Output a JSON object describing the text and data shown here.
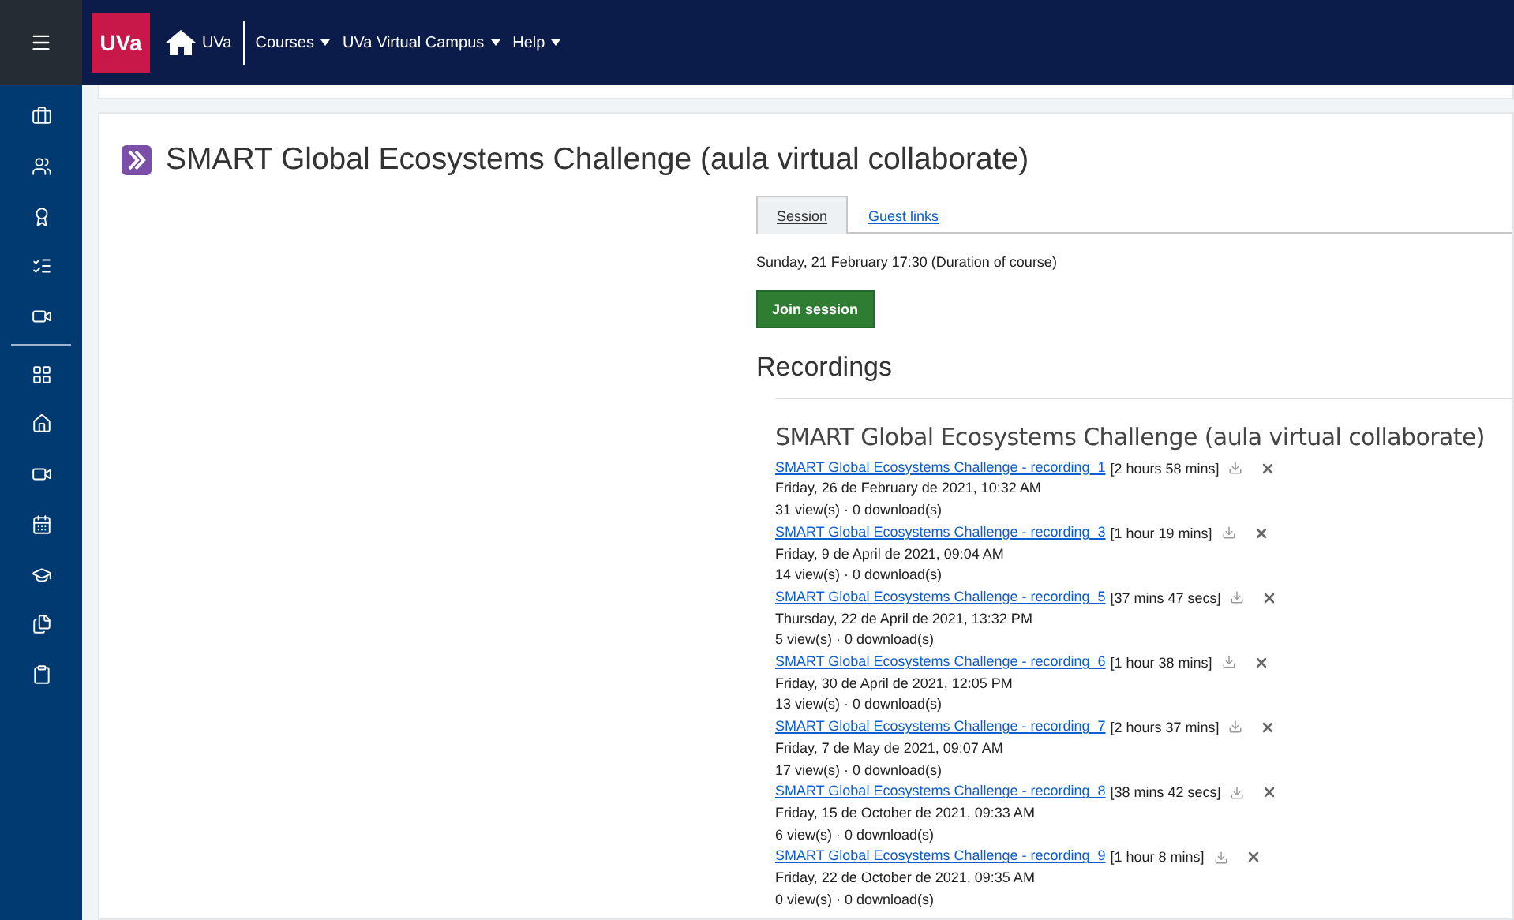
{
  "navbar": {
    "logo": "UVa",
    "home_label": "UVa",
    "menus": [
      {
        "label": "Courses"
      },
      {
        "label": "UVa Virtual Campus"
      },
      {
        "label": "Help"
      }
    ]
  },
  "page": {
    "title": "SMART Global Ecosystems Challenge (aula virtual collaborate)",
    "tabs": [
      {
        "label": "Session",
        "selected": true
      },
      {
        "label": "Guest links",
        "selected": false
      }
    ],
    "session_time": "Sunday, 21 February 17:30 (Duration of course)",
    "join_button": "Join session",
    "recordings_heading": "Recordings",
    "recordings_title": "SMART Global Ecosystems Challenge (aula virtual collaborate)",
    "recordings": [
      {
        "link": "SMART Global Ecosystems Challenge - recording_1",
        "duration": "[2 hours 58 mins]",
        "date": "Friday, 26 de February de 2021, 10:32 AM",
        "stats": "31 view(s) · 0 download(s)"
      },
      {
        "link": "SMART Global Ecosystems Challenge - recording_3",
        "duration": "[1 hour 19 mins]",
        "date": "Friday, 9 de April de 2021, 09:04 AM",
        "stats": "14 view(s) · 0 download(s)"
      },
      {
        "link": "SMART Global Ecosystems Challenge - recording_5",
        "duration": "[37 mins 47 secs]",
        "date": "Thursday, 22 de April de 2021, 13:32 PM",
        "stats": "5 view(s) · 0 download(s)"
      },
      {
        "link": "SMART Global Ecosystems Challenge - recording_6",
        "duration": "[1 hour 38 mins]",
        "date": "Friday, 30 de April de 2021, 12:05 PM",
        "stats": "13 view(s) · 0 download(s)"
      },
      {
        "link": "SMART Global Ecosystems Challenge - recording_7",
        "duration": "[2 hours 37 mins]",
        "date": "Friday, 7 de May de 2021, 09:07 AM",
        "stats": "17 view(s) · 0 download(s)"
      },
      {
        "link": "SMART Global Ecosystems Challenge - recording_8",
        "duration": "[38 mins 42 secs]",
        "date": "Friday, 15 de October de 2021, 09:33 AM",
        "stats": "6 view(s) · 0 download(s)"
      },
      {
        "link": "SMART Global Ecosystems Challenge - recording_9",
        "duration": "[1 hour 8 mins]",
        "date": "Friday, 22 de October de 2021, 09:35 AM",
        "stats": "0 view(s) · 0 download(s)"
      }
    ]
  }
}
